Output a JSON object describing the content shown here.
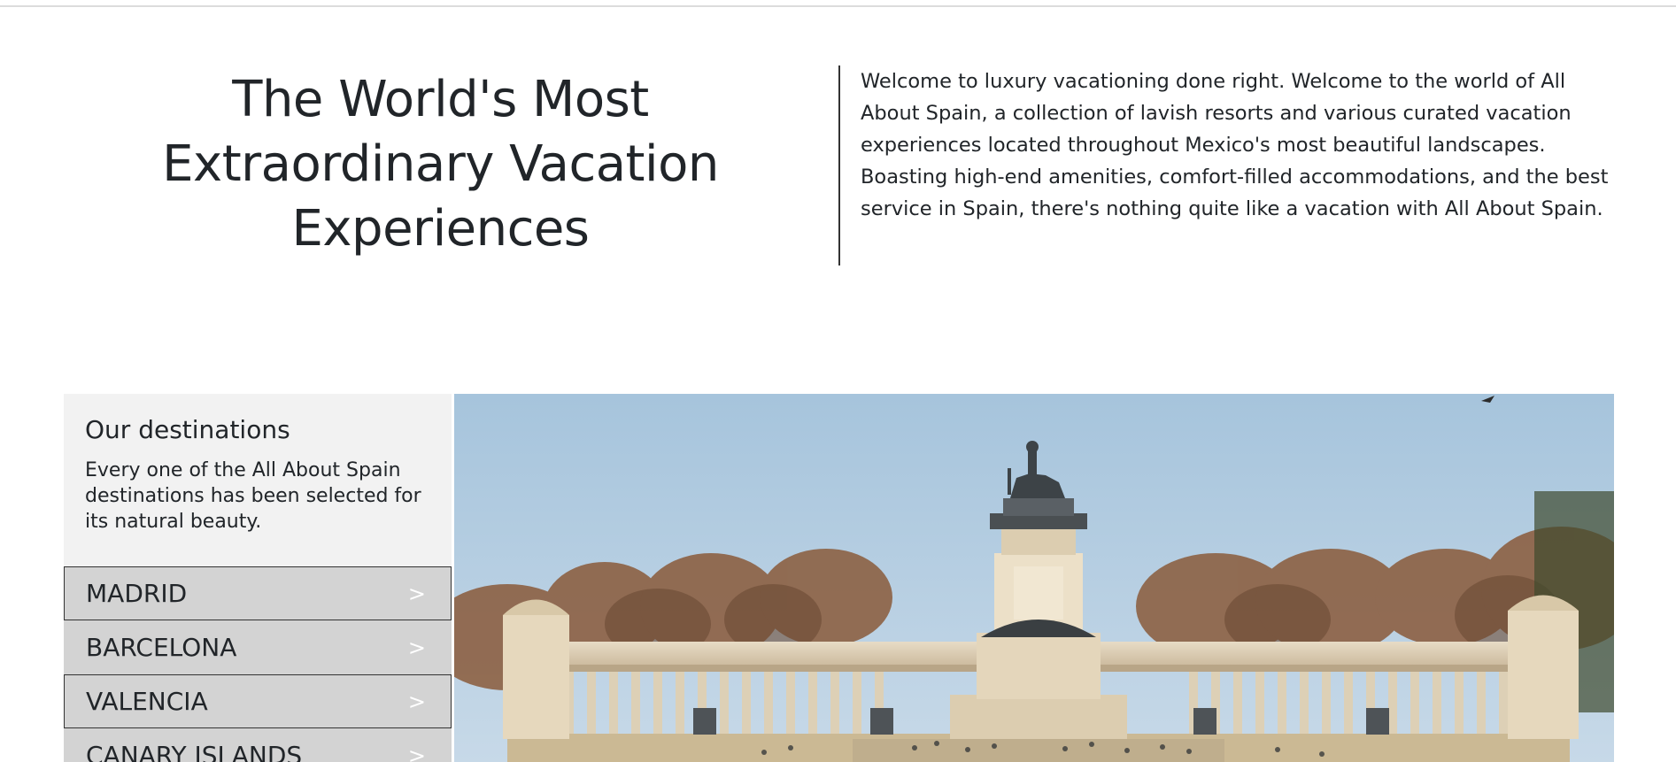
{
  "intro": {
    "title": "The World's Most Extraordinary Vacation Experiences",
    "text": "Welcome to luxury vacationing done right. Welcome to the world of All About Spain, a collection of lavish resorts and various curated vacation experiences located throughout Mexico's most beautiful landscapes. Boasting high-end amenities, comfort-filled accommodations, and the best service in Spain, there's nothing quite like a vacation with All About Spain."
  },
  "destinations": {
    "heading": "Our destinations",
    "description": "Every one of the All About Spain destinations has been selected for its natural beauty.",
    "items": [
      {
        "label": "MADRID",
        "chevron": ">"
      },
      {
        "label": "BARCELONA",
        "chevron": ">"
      },
      {
        "label": "VALENCIA",
        "chevron": ">"
      },
      {
        "label": "CANARY ISLANDS",
        "chevron": ">"
      }
    ]
  },
  "colors": {
    "panel_bg": "#f2f2f2",
    "item_bg": "#d3d3d3",
    "sky": "#a9c8e0",
    "text": "#212529"
  }
}
